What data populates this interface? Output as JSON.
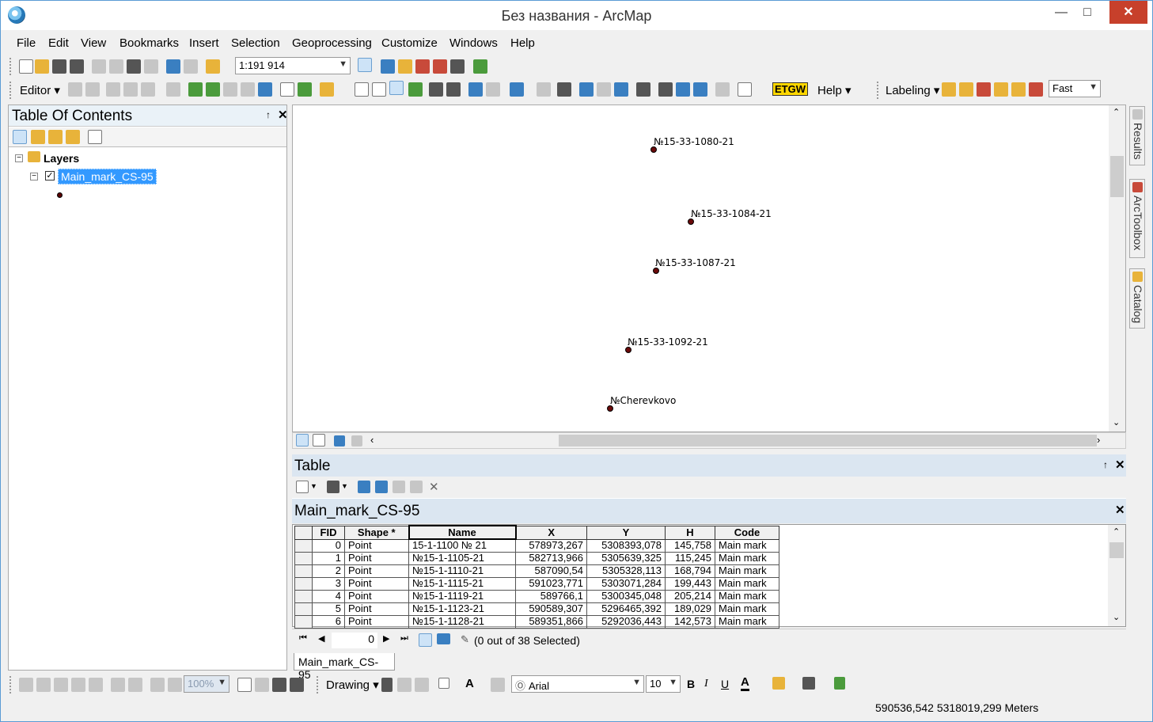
{
  "window": {
    "title": "Без названия - ArcMap",
    "minimize": "—",
    "maximize": "□",
    "close": "✕"
  },
  "menu": {
    "file": "File",
    "edit": "Edit",
    "view": "View",
    "bookmarks": "Bookmarks",
    "insert": "Insert",
    "selection": "Selection",
    "geoprocessing": "Geoprocessing",
    "customize": "Customize",
    "windows": "Windows",
    "help": "Help"
  },
  "standard_toolbar": {
    "scale": "1:191 914"
  },
  "tools_toolbar": {
    "editor": "Editor",
    "etgw": "ETGW",
    "help": "Help",
    "labeling": "Labeling",
    "quality": "Fast"
  },
  "toc": {
    "title": "Table Of Contents",
    "pin": "↑",
    "close": "✕",
    "layers_label": "Layers",
    "layer_name": "Main_mark_CS-95",
    "layer_checked": "✓"
  },
  "map": {
    "points": [
      {
        "label": "№15-33-1080-21"
      },
      {
        "label": "№15-33-1084-21"
      },
      {
        "label": "№15-33-1087-21"
      },
      {
        "label": "№15-33-1092-21"
      },
      {
        "label": "№Cherevkovo"
      }
    ],
    "symbol_color": "#6a0a0a"
  },
  "dock": {
    "results": "Results",
    "arctoolbox": "ArcToolbox",
    "catalog": "Catalog"
  },
  "table": {
    "title": "Table",
    "layer_title": "Main_mark_CS-95",
    "columns": [
      "FID",
      "Shape *",
      "Name",
      "X",
      "Y",
      "H",
      "Code"
    ],
    "rows": [
      [
        "0",
        "Point",
        "15-1-1100 № 21",
        "578973,267",
        "5308393,078",
        "145,758",
        "Main mark"
      ],
      [
        "1",
        "Point",
        "№15-1-1105-21",
        "582713,966",
        "5305639,325",
        "115,245",
        "Main mark"
      ],
      [
        "2",
        "Point",
        "№15-1-1110-21",
        "587090,54",
        "5305328,113",
        "168,794",
        "Main mark"
      ],
      [
        "3",
        "Point",
        "№15-1-1115-21",
        "591023,771",
        "5303071,284",
        "199,443",
        "Main mark"
      ],
      [
        "4",
        "Point",
        "№15-1-1119-21",
        "589766,1",
        "5300345,048",
        "205,214",
        "Main mark"
      ],
      [
        "5",
        "Point",
        "№15-1-1123-21",
        "590589,307",
        "5296465,392",
        "189,029",
        "Main mark"
      ],
      [
        "6",
        "Point",
        "№15-1-1128-21",
        "589351,866",
        "5292036,443",
        "142,573",
        "Main mark"
      ]
    ],
    "record": "0",
    "selection_status": "(0 out of 38 Selected)",
    "tab_label": "Main_mark_CS-95"
  },
  "draw_toolbar": {
    "zoom": "100%",
    "drawing": "Drawing",
    "font": "Arial",
    "font_size": "10",
    "bold": "B",
    "italic": "I",
    "underline": "U",
    "font_color": "A"
  },
  "status": {
    "coordinates": "590536,542  5318019,299 Meters"
  }
}
